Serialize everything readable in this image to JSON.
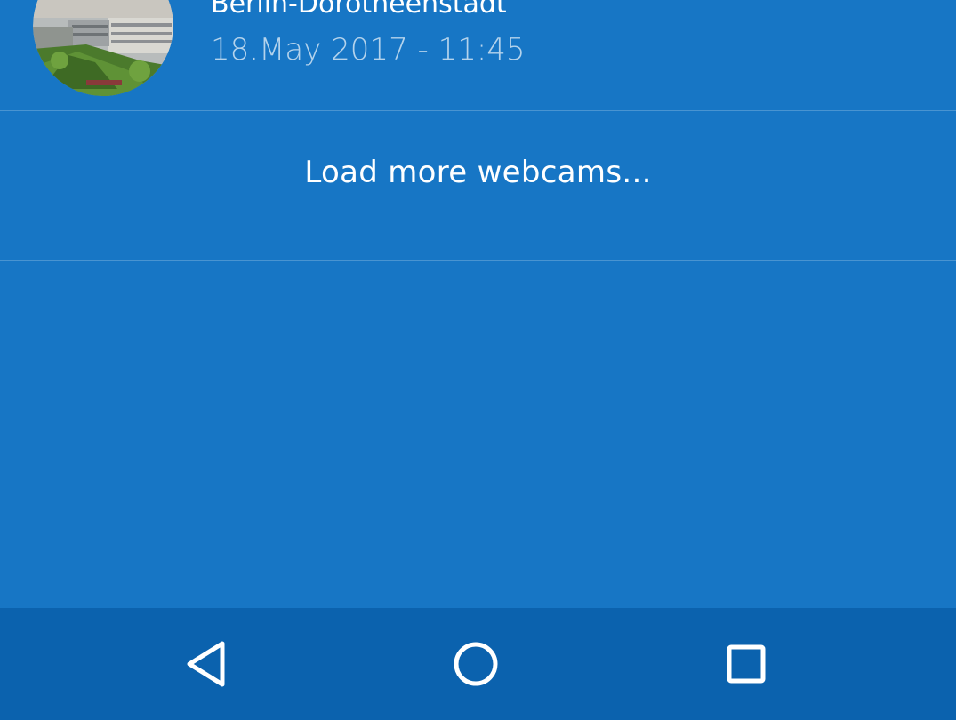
{
  "webcam": {
    "title": "Berlin-Dorotheenstadt",
    "timestamp": "18.May 2017 - 11:45"
  },
  "load_more": {
    "label": "Load more webcams..."
  },
  "colors": {
    "background": "#1776c5",
    "navbar": "#0b62ae",
    "text_primary": "#ffffff"
  },
  "navbar": {
    "icons": [
      "back-icon",
      "home-icon",
      "recents-icon"
    ]
  }
}
